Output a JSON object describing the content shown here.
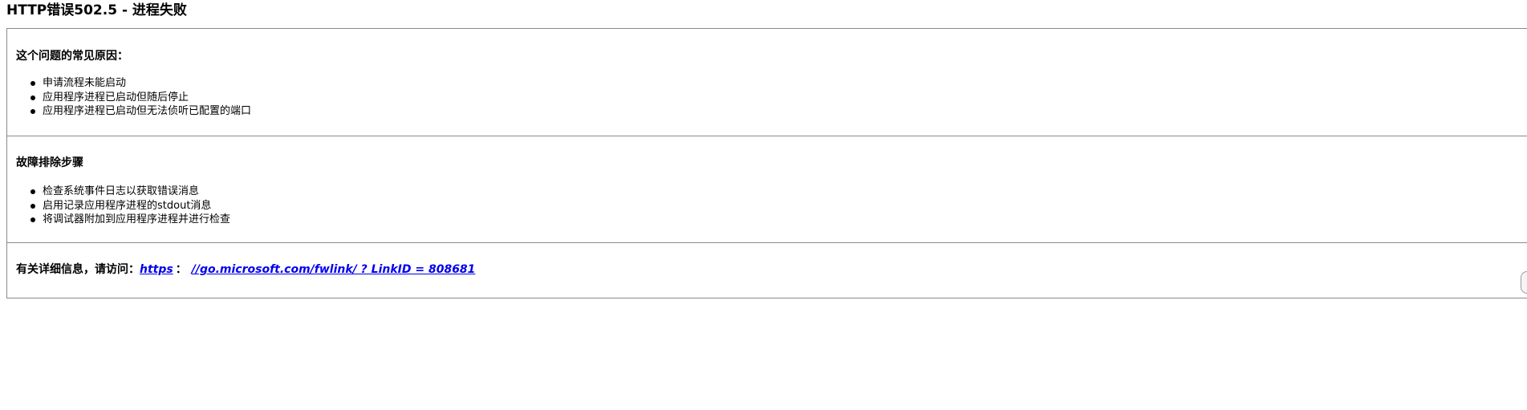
{
  "page": {
    "title": "HTTP错误502.5 - 进程失败"
  },
  "causes": {
    "heading": "这个问题的常见原因：",
    "items": [
      "申请流程未能启动",
      "应用程序进程已启动但随后停止",
      "应用程序进程已启动但无法侦听已配置的端口"
    ]
  },
  "troubleshooting": {
    "heading": "故障排除步骤",
    "items": [
      "检查系统事件日志以获取错误消息",
      "启用记录应用程序进程的stdout消息",
      "将调试器附加到应用程序进程并进行检查"
    ]
  },
  "more_info": {
    "label": "有关详细信息，请访问：",
    "link_scheme": "https",
    "separator": "：",
    "link_rest": "//go.microsoft.com/fwlink/ ? LinkID = 808681"
  },
  "colors": {
    "link": "#0000ee",
    "border": "#8a8a8a",
    "text": "#000000"
  },
  "icons": {
    "list_bullet": "bullet-dot-icon"
  }
}
